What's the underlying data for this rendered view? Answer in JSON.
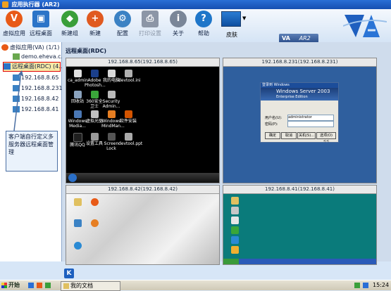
{
  "window": {
    "title": "应用执行器 (AR2)"
  },
  "toolbar": {
    "buttons": [
      {
        "label": "虚拟应用",
        "icon": "virtual-app-icon",
        "color": "#e85a17"
      },
      {
        "label": "远程桌面",
        "icon": "remote-desktop-icon",
        "color": "#2b74c8"
      },
      {
        "label": "新建组",
        "icon": "new-group-icon",
        "color": "#3a9f3a"
      },
      {
        "label": "新建",
        "icon": "new-icon",
        "color": "#e05a20"
      },
      {
        "label": "配置",
        "icon": "configure-icon",
        "color": "#3b82c4"
      },
      {
        "label": "打印设置",
        "icon": "printer-icon",
        "color": "#8c96a6"
      },
      {
        "label": "关于",
        "icon": "info-icon",
        "color": "#7a8698"
      },
      {
        "label": "帮助",
        "icon": "help-icon",
        "color": "#1e76c9"
      }
    ],
    "skin_label": "皮肤",
    "brand_va": "VA",
    "brand_ar2": "AR2"
  },
  "sidebar": {
    "tree": [
      {
        "label": "虚拟应用(VA) (1/1)",
        "level": 0
      },
      {
        "label": "demo.eheva.c...",
        "level": 1
      },
      {
        "label": "远程桌面(RDC) (4...",
        "level": 0,
        "selected": true
      },
      {
        "label": "192.168.8.65",
        "level": 1
      },
      {
        "label": "192.168.8.231",
        "level": 1
      },
      {
        "label": "192.168.8.42",
        "level": 1
      },
      {
        "label": "192.168.8.41",
        "level": 1
      }
    ],
    "tooltip": "客户端自行定义多服务器远程桌面管理"
  },
  "main": {
    "title": "远程桌面(RDC)",
    "panels": [
      {
        "caption": "192.168.8.65(192.168.8.65)",
        "icons": [
          "ca_admin",
          "Adobe Photosh...",
          "我的电脑",
          "devtool.ini",
          "回收站",
          "360安全卫士",
          "Security Admin...",
          "Windows Media...",
          "虚拟光驱",
          "Windows MindMan...",
          "软件安装",
          "腾讯QQ",
          "设置工具",
          "Screen Lock",
          "devtool.ppt"
        ]
      },
      {
        "caption": "192.168.8.231(192.168.8.231)",
        "login": {
          "header": "登录到 Windows",
          "product": "Windows Server 2003",
          "edition": "Enterprise Edition",
          "user_label": "用户名(U):",
          "user_value": "administrator",
          "pass_label": "密码(P):",
          "ok": "确定",
          "cancel": "取消",
          "shutdown": "关机(S)...",
          "options": "选项(O) <<"
        }
      },
      {
        "caption": "192.168.8.42(192.168.8.42)"
      },
      {
        "caption": "192.168.8.41(192.168.8.41)"
      }
    ]
  },
  "taskbar": {
    "start_label": "开始",
    "doc_label": "我的文档",
    "clock": "15:24"
  }
}
